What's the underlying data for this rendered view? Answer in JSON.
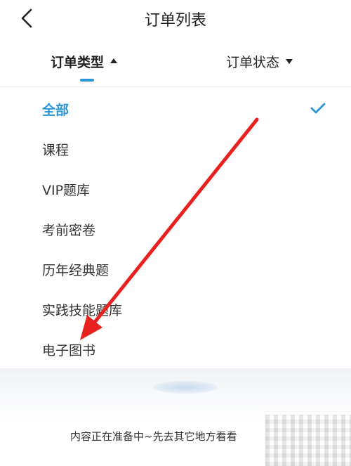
{
  "header": {
    "title": "订单列表",
    "back_icon": "chevron-left-icon"
  },
  "filters": {
    "type_label": "订单类型",
    "status_label": "订单状态",
    "active": "type"
  },
  "dropdown": {
    "options": [
      {
        "label": "全部",
        "selected": true
      },
      {
        "label": "课程",
        "selected": false
      },
      {
        "label": "VIP题库",
        "selected": false
      },
      {
        "label": "考前密卷",
        "selected": false
      },
      {
        "label": "历年经典题",
        "selected": false
      },
      {
        "label": "实践技能题库",
        "selected": false
      },
      {
        "label": "电子图书",
        "selected": false
      }
    ],
    "selected_icon": "check-icon"
  },
  "empty_state": {
    "message": "内容正在准备中~先去其它地方看看"
  },
  "colors": {
    "accent": "#2b95d6",
    "arrow": "#e8211f",
    "text": "#333333"
  }
}
